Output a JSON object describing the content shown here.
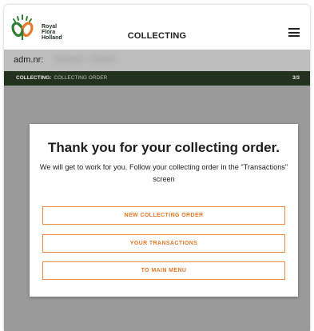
{
  "header": {
    "logo_lines": [
      "Royal",
      "Flora",
      "Holland"
    ],
    "title": "COLLECTING",
    "menu_icon": "hamburger-menu-icon"
  },
  "adm": {
    "label": "adm.nr:",
    "value": "000000 - 00000"
  },
  "progress": {
    "step_label": "COLLECTING:",
    "step_name": "COLLECTING ORDER",
    "count": "3/3"
  },
  "modal": {
    "title": "Thank you for your collecting order.",
    "message": "We will get to work for you. Follow your collecting order in the \"Transactions\" screen",
    "buttons": {
      "new_order": "NEW COLLECTING ORDER",
      "transactions": "YOUR TRANSACTIONS",
      "main_menu": "TO MAIN MENU"
    }
  },
  "colors": {
    "accent": "#ef8a3a",
    "progress_bar": "#23321f",
    "logo_green": "#2e7d32",
    "logo_orange": "#e9792a"
  }
}
